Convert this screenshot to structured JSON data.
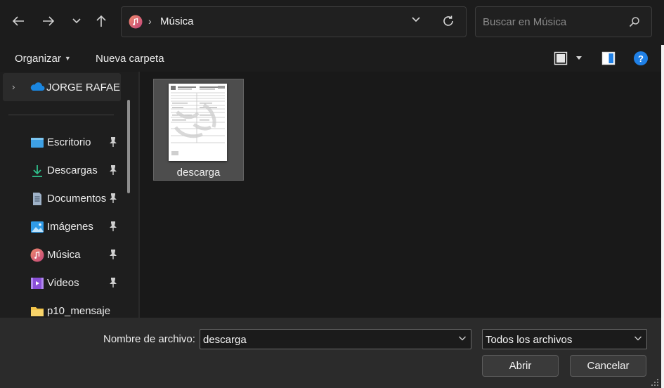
{
  "address": {
    "current_folder": "Música"
  },
  "search": {
    "placeholder": "Buscar en Música"
  },
  "commandbar": {
    "organize_label": "Organizar",
    "new_folder_label": "Nueva carpeta"
  },
  "sidebar": {
    "root_label": "JORGE RAFAEL, P",
    "items": [
      {
        "label": "Escritorio",
        "icon": "desktop-icon",
        "pinned": true
      },
      {
        "label": "Descargas",
        "icon": "downloads-icon",
        "pinned": true
      },
      {
        "label": "Documentos",
        "icon": "documents-icon",
        "pinned": true
      },
      {
        "label": "Imágenes",
        "icon": "pictures-icon",
        "pinned": true
      },
      {
        "label": "Música",
        "icon": "music-icon",
        "pinned": true
      },
      {
        "label": "Videos",
        "icon": "videos-icon",
        "pinned": true
      },
      {
        "label": "p10_mensaje",
        "icon": "folder-icon",
        "pinned": false
      }
    ]
  },
  "files": [
    {
      "name": "descarga",
      "selected": true
    }
  ],
  "footer": {
    "filename_label": "Nombre de archivo:",
    "filename_value": "descarga",
    "filetype_value": "Todos los archivos",
    "open_label": "Abrir",
    "cancel_label": "Cancelar"
  },
  "colors": {
    "background": "#191919",
    "bar": "#1c1c1c",
    "footer": "#2b2b2b",
    "selection": "#4d4d4d",
    "accent": "#1f80e6"
  }
}
